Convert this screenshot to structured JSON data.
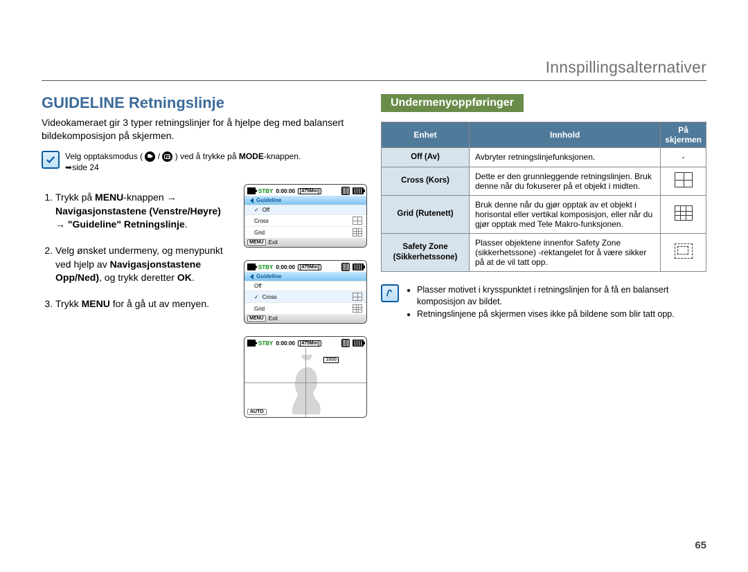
{
  "header": {
    "title": "Innspillingsalternativer"
  },
  "section": {
    "title": "GUIDELINE Retningslinje"
  },
  "intro": "Videokameraet gir 3 typer retningslinjer for å hjelpe deg med balansert bildekomposisjon på skjermen.",
  "note": {
    "pre": "Velg opptaksmodus (",
    "sep": " / ",
    "post_a": " ) ved å trykke på ",
    "mode": "MODE",
    "post_b": "-knappen.",
    "pageref": "side 24"
  },
  "steps": {
    "s1_a": "Trykk på ",
    "s1_menu": "MENU",
    "s1_b": "-knappen ",
    "s1_arrow1": "→",
    "s1_nav": "Navigasjonstastene (Venstre/Høyre)",
    "s1_arrow2": " → ",
    "s1_gquote": "\"Guideline\" Retningslinje",
    "s1_c": ".",
    "s2_a": "Velg ønsket undermeny, og menypunkt ved hjelp av ",
    "s2_nav": "Navigasjonstastene Opp/Ned)",
    "s2_b": ", og trykk deretter ",
    "s2_ok": "OK",
    "s2_c": ".",
    "s3_a": "Trykk ",
    "s3_menu": "MENU",
    "s3_b": " for å gå ut av menyen."
  },
  "lcd": {
    "stby": "STBY",
    "time": "0:00:00",
    "remain": "[475Min]",
    "guideline": "Guideline",
    "off": "Off",
    "cross": "Cross",
    "grid": "Grid",
    "menu": "MENU",
    "exit": "Exit",
    "threek": "3999",
    "auto": "AUTO"
  },
  "sub": {
    "title": "Undermenyoppføringer",
    "th_item": "Enhet",
    "th_content": "Innhold",
    "th_screen_line1": "På",
    "th_screen_line2": "skjermen",
    "rows": [
      {
        "item": "Off (Av)",
        "content": "Avbryter retningslinjefunksjonen.",
        "icon": "-"
      },
      {
        "item": "Cross (Kors)",
        "content": "Dette er den grunnleggende retningslinjen. Bruk denne når du fokuserer på et objekt i midten."
      },
      {
        "item": "Grid (Rutenett)",
        "content": "Bruk denne når du gjør opptak av et objekt i horisontal eller vertikal komposisjon, eller når du gjør opptak med Tele Makro-funksjonen."
      },
      {
        "item": "Safety Zone (Sikkerhetssone)",
        "content": "Plasser objektene innenfor Safety Zone (sikkerhetssone) -rektangelet for å være sikker på at de vil tatt opp."
      }
    ]
  },
  "info": {
    "b1": "Plasser motivet i krysspunktet i retningslinjen for å få en balansert komposisjon av bildet.",
    "b2": "Retningslinjene på skjermen vises ikke på bildene som blir tatt opp."
  },
  "page_number": "65"
}
